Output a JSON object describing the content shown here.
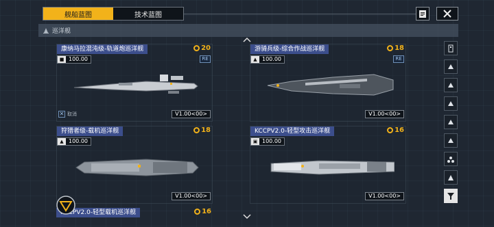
{
  "tabs": [
    {
      "label": "舰船蓝图",
      "active": true
    },
    {
      "label": "技术蓝图",
      "active": false
    }
  ],
  "toolbar": {
    "doc_icon": "document-icon",
    "close_icon": "close-icon"
  },
  "section": {
    "title": "巡洋舰",
    "icon": "cruiser-class-icon"
  },
  "cards": [
    {
      "name": "康纳马拉混沌级-轨道炮巡洋舰",
      "cost": "20",
      "stat_value": "100.00",
      "stat_icon": "armor-icon",
      "badge": "RE",
      "version": "V1.00<00>",
      "cancel": "取消"
    },
    {
      "name": "游骑兵级-综合作战巡洋舰",
      "cost": "18",
      "stat_value": "100.00",
      "stat_icon": "thrust-icon",
      "badge": "RE",
      "version": "V1.00<00>"
    },
    {
      "name": "狩猎者级-载机巡洋舰",
      "cost": "18",
      "stat_value": "100.00",
      "stat_icon": "thrust-icon",
      "version": "V1.00<00>"
    },
    {
      "name": "KCCPV2.0-轻型攻击巡洋舰",
      "cost": "16",
      "stat_value": "100.00",
      "stat_icon": "shield-icon",
      "version": "V1.00<00>"
    },
    {
      "name": "KCCPV2.0-轻型载机巡洋舰",
      "cost": "16"
    }
  ],
  "colors": {
    "accent": "#f2b21a",
    "name_bg": "#3c4e8c",
    "panel": "#1f2732"
  }
}
